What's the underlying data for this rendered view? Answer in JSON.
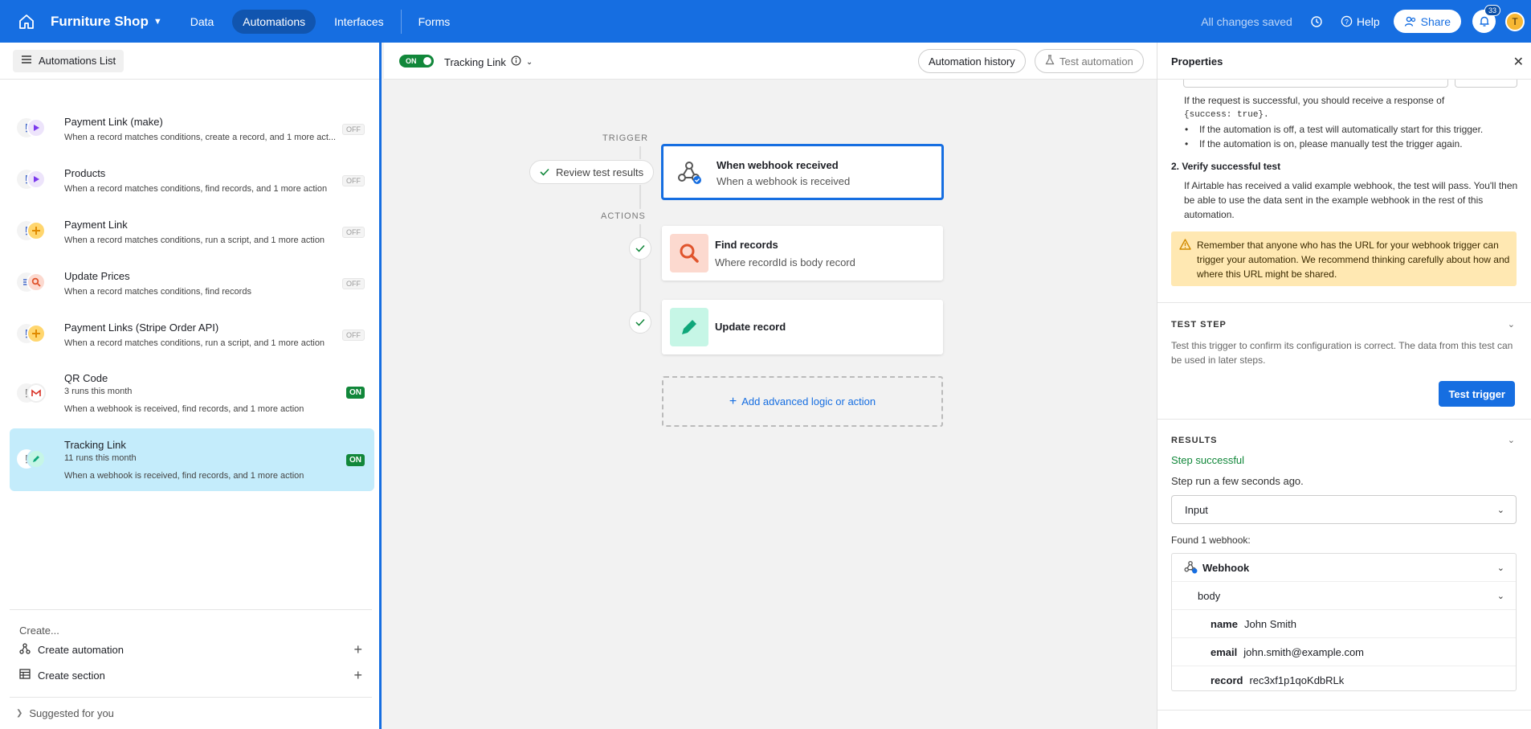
{
  "topbar": {
    "brand": "Furniture Shop",
    "tabs": [
      "Data",
      "Automations",
      "Interfaces",
      "Forms"
    ],
    "saved_status": "All changes saved",
    "help": "Help",
    "share": "Share",
    "notification_count": "33",
    "avatar_initial": "T"
  },
  "sidebar": {
    "list_button": "Automations List",
    "automations": [
      {
        "name": "Payment Link (make)",
        "runs": "",
        "desc": "When a record matches conditions, create a record, and 1 more act...",
        "status": "OFF"
      },
      {
        "name": "Products",
        "runs": "",
        "desc": "When a record matches conditions, find records, and 1 more action",
        "status": "OFF"
      },
      {
        "name": "Payment Link",
        "runs": "",
        "desc": "When a record matches conditions, run a script, and 1 more action",
        "status": "OFF"
      },
      {
        "name": "Update Prices",
        "runs": "",
        "desc": "When a record matches conditions, find records",
        "status": "OFF"
      },
      {
        "name": "Payment Links (Stripe Order API)",
        "runs": "",
        "desc": "When a record matches conditions, run a script, and 1 more action",
        "status": "OFF"
      },
      {
        "name": "QR Code",
        "runs": "3 runs this month",
        "desc": "When a webhook is received, find records, and 1 more action",
        "status": "ON"
      },
      {
        "name": "Tracking Link",
        "runs": "11 runs this month",
        "desc": "When a webhook is received, find records, and 1 more action",
        "status": "ON"
      }
    ],
    "create_label": "Create...",
    "create_automation": "Create automation",
    "create_section": "Create section",
    "suggested": "Suggested for you"
  },
  "center": {
    "toggle": "ON",
    "automation_name": "Tracking Link",
    "automation_history": "Automation history",
    "test_automation": "Test automation",
    "trigger_label": "TRIGGER",
    "actions_label": "ACTIONS",
    "review_results": "Review test results",
    "trigger_card": {
      "title": "When webhook received",
      "sub": "When a webhook is received"
    },
    "find_card": {
      "title": "Find records",
      "sub": "Where recordId is body record"
    },
    "update_card": {
      "title": "Update record"
    },
    "add_logic": "Add advanced logic or action"
  },
  "panel": {
    "title": "Properties",
    "success_text_1": "If the request is successful, you should receive a response of",
    "success_code": "{success: true}.",
    "bullet_1": "If the automation is off, a test will automatically start for this trigger.",
    "bullet_2": "If the automation is on, please manually test the trigger again.",
    "verify_heading": "2. Verify successful test",
    "verify_text": "If Airtable has received a valid example webhook, the test will pass. You'll then be able to use the data sent in the example webhook in the rest of this automation.",
    "warning": "Remember that anyone who has the URL for your webhook trigger can trigger your automation. We recommend thinking carefully about how and where this URL might be shared.",
    "test_step_title": "TEST STEP",
    "test_step_text": "Test this trigger to confirm its configuration is correct. The data from this test can be used in later steps.",
    "test_trigger": "Test trigger",
    "results_title": "RESULTS",
    "step_successful": "Step successful",
    "step_run": "Step run a few seconds ago.",
    "input_select": "Input",
    "found": "Found 1 webhook:",
    "webhook_label": "Webhook",
    "body_label": "body",
    "fields": [
      {
        "key": "name",
        "value": "John Smith"
      },
      {
        "key": "email",
        "value": "john.smith@example.com"
      },
      {
        "key": "record",
        "value": "rec3xf1p1qoKdbRLk"
      }
    ]
  },
  "colors": {
    "brand_blue": "#166ee1",
    "on_green": "#11873a",
    "selected_row": "#c4ecfb",
    "warning_bg": "#ffe8b2"
  }
}
